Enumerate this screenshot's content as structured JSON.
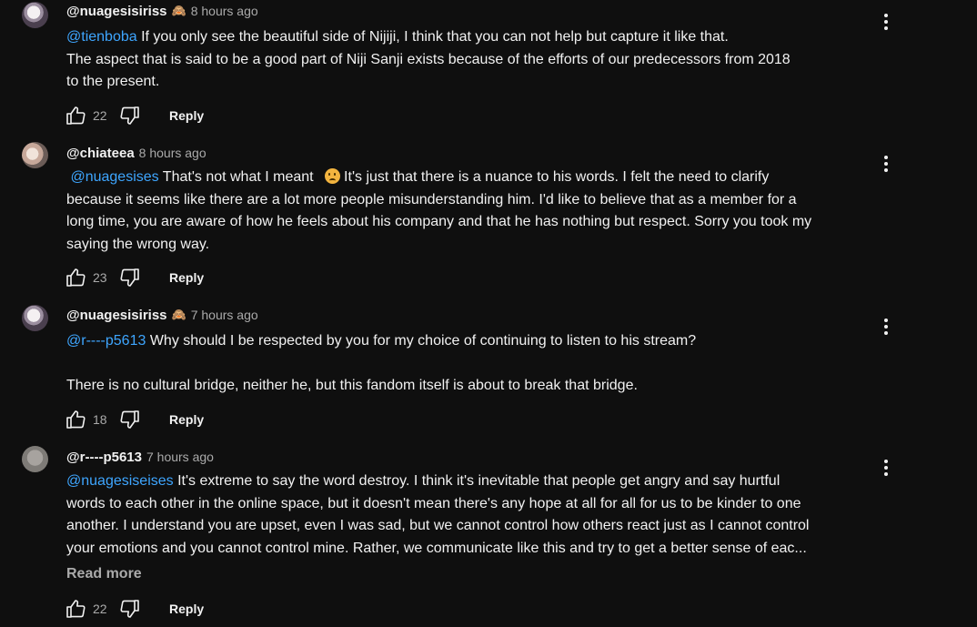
{
  "comments": [
    {
      "author": "@nuagesisiriss",
      "badge": "🙈",
      "time": "8 hours ago",
      "mention": "@tienboba",
      "lines": [
        " If you only see the beautiful side of Nijiji, I think that you can not help but capture it like that.",
        "The aspect that is said to be a good part of Niji Sanji exists because of the efforts of our predecessors from 2018",
        "to the present."
      ],
      "likes": "22",
      "reply_label": "Reply"
    },
    {
      "author": "@chiateea",
      "time": "8 hours ago",
      "mention": "@nuagesises",
      "first_line_text": " That's not what I meant ",
      "emoji": "slightly-frowning-face",
      "first_line_rest": "It's just that there is a nuance to his words. I felt the need to clarify",
      "lines": [
        "because it seems like there are a lot more people misunderstanding him. I'd like to believe that as a member for a",
        "long time, you are aware of how he feels about his company and that he has nothing but respect. Sorry you took my",
        "saying the wrong way."
      ],
      "likes": "23",
      "reply_label": "Reply"
    },
    {
      "author": "@nuagesisiriss",
      "badge": "🙈",
      "time": "7 hours ago",
      "mention": "@r----p5613",
      "lines": [
        " Why should I be respected by you for my choice of continuing to listen to his stream?",
        "",
        "There is no cultural bridge, neither he, but this fandom itself is about to break that bridge."
      ],
      "likes": "18",
      "reply_label": "Reply"
    },
    {
      "author": "@r----p5613",
      "time": "7 hours ago",
      "mention": "@nuagesiseises",
      "lines": [
        " It's extreme to say the word destroy. I think it's inevitable that people get angry and say hurtful",
        "words to each other in the online space, but it doesn't mean there's any hope at all for all for us to be kinder to one",
        "another. I understand you are upset, even I was sad, but we cannot control how others react just as I cannot control",
        "your emotions and you cannot control mine. Rather, we communicate like this and try to get a better sense of eac..."
      ],
      "read_more": "Read more",
      "likes": "22",
      "reply_label": "Reply"
    }
  ],
  "icons": {
    "like": "thumbs-up-icon",
    "dislike": "thumbs-down-icon",
    "more": "more-vertical-icon"
  }
}
